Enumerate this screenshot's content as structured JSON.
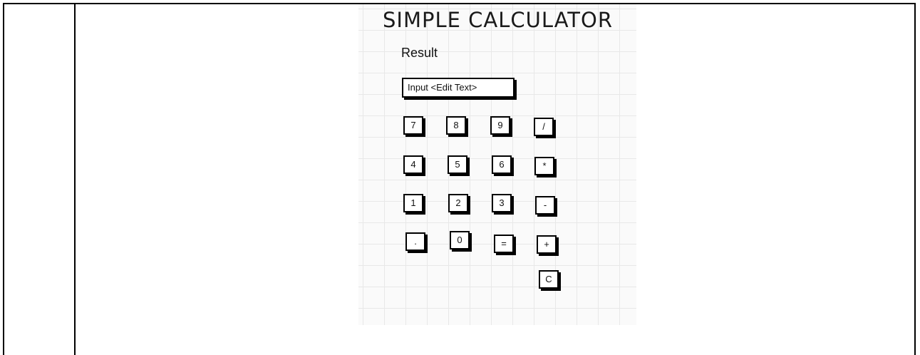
{
  "mockup": {
    "title": "SIMPLE CALCULATOR",
    "result_label": "Result",
    "input_label": "Input <Edit Text>",
    "keys": [
      {
        "label": "7"
      },
      {
        "label": "8"
      },
      {
        "label": "9"
      },
      {
        "label": "/"
      },
      {
        "label": "4"
      },
      {
        "label": "5"
      },
      {
        "label": "6"
      },
      {
        "label": "*"
      },
      {
        "label": "1"
      },
      {
        "label": "2"
      },
      {
        "label": "3"
      },
      {
        "label": "-"
      },
      {
        "label": "."
      },
      {
        "label": "0"
      },
      {
        "label": "="
      },
      {
        "label": "+"
      },
      {
        "label": "C"
      }
    ]
  }
}
